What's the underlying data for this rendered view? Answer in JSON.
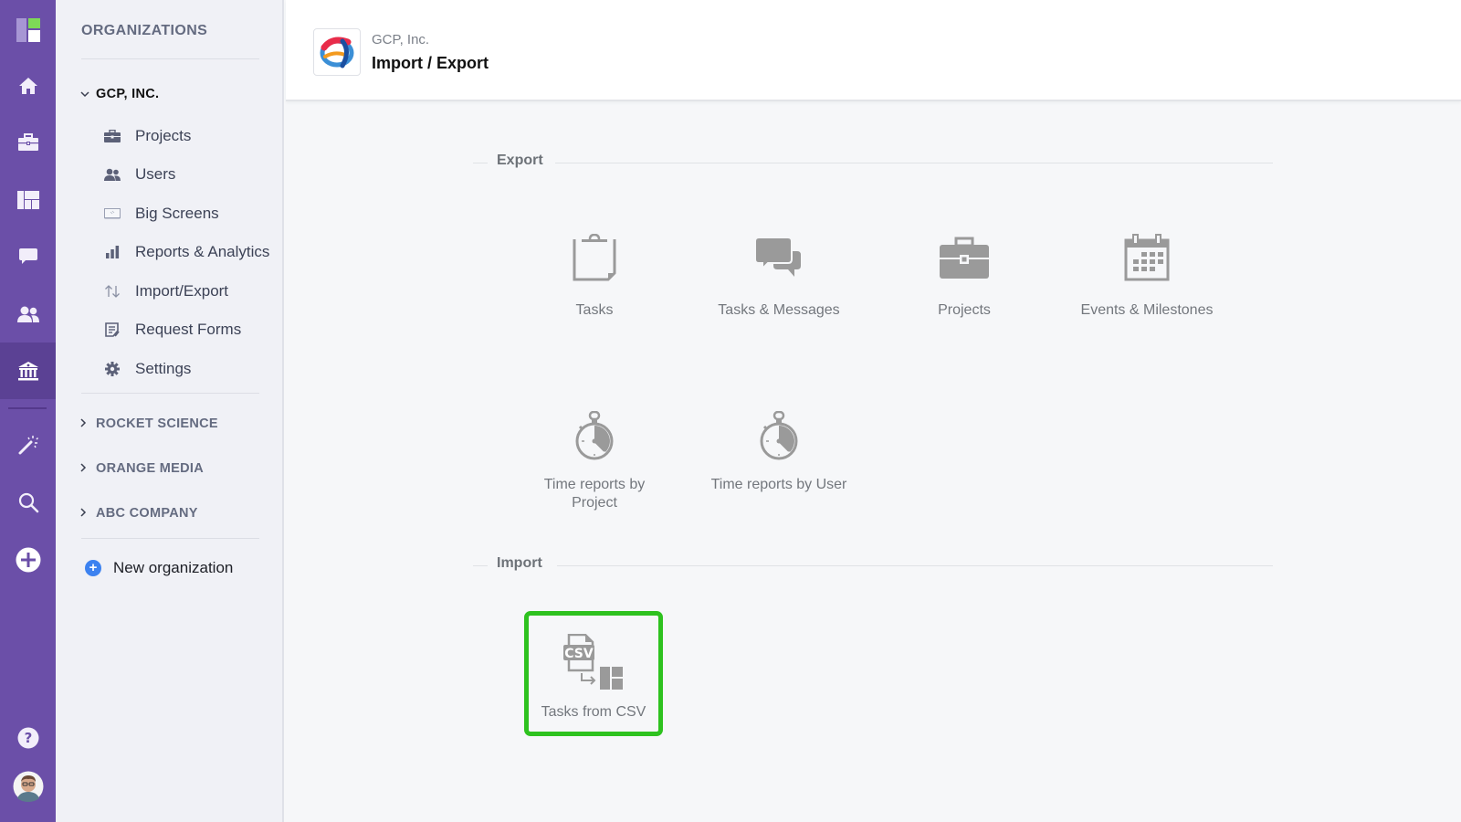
{
  "rail": {
    "items": [
      {
        "name": "app-logo",
        "icon": "app-logo-icon"
      },
      {
        "name": "home",
        "icon": "home-icon"
      },
      {
        "name": "projects",
        "icon": "briefcase-icon"
      },
      {
        "name": "boards",
        "icon": "dashboard-icon"
      },
      {
        "name": "messages",
        "icon": "chat-icon"
      },
      {
        "name": "users",
        "icon": "users-icon"
      },
      {
        "name": "organizations",
        "icon": "bank-icon",
        "active": true
      },
      {
        "name": "magic",
        "icon": "magic-wand-icon"
      },
      {
        "name": "search",
        "icon": "search-icon"
      },
      {
        "name": "add",
        "icon": "plus-circle-icon"
      },
      {
        "name": "help",
        "icon": "help-icon"
      },
      {
        "name": "profile",
        "icon": "avatar"
      }
    ],
    "colors": {
      "background": "#6b4fa8",
      "active": "#5b4194",
      "logo_green": "#7ed957"
    }
  },
  "sidebar": {
    "title": "ORGANIZATIONS",
    "current_org": {
      "name": "GCP, INC.",
      "expanded": true,
      "items": [
        {
          "label": "Projects",
          "icon": "briefcase-icon"
        },
        {
          "label": "Users",
          "icon": "users-icon"
        },
        {
          "label": "Big Screens",
          "icon": "screen-icon"
        },
        {
          "label": "Reports & Analytics",
          "icon": "bar-chart-icon"
        },
        {
          "label": "Import/Export",
          "icon": "arrows-up-down-icon"
        },
        {
          "label": "Request Forms",
          "icon": "form-icon"
        },
        {
          "label": "Settings",
          "icon": "gear-icon"
        }
      ]
    },
    "other_orgs": [
      {
        "name": "ROCKET SCIENCE"
      },
      {
        "name": "ORANGE MEDIA"
      },
      {
        "name": "ABC COMPANY"
      }
    ],
    "new_org_label": "New organization",
    "new_org_icon": "+"
  },
  "header": {
    "org_name": "GCP, Inc.",
    "title": "Import / Export"
  },
  "export": {
    "title": "Export",
    "items": [
      {
        "label": "Tasks",
        "icon": "clipboard-icon"
      },
      {
        "label": "Tasks & Messages",
        "icon": "chat-bubbles-icon"
      },
      {
        "label": "Projects",
        "icon": "briefcase-icon"
      },
      {
        "label": "Events & Milestones",
        "icon": "calendar-icon"
      },
      {
        "label": "Time reports by Project",
        "icon": "stopwatch-icon"
      },
      {
        "label": "Time reports by User",
        "icon": "stopwatch-icon"
      }
    ]
  },
  "import": {
    "title": "Import",
    "items": [
      {
        "label": "Tasks from CSV",
        "icon": "csv-import-icon",
        "highlighted": true
      }
    ]
  },
  "colors": {
    "highlight_border": "#2ec21f",
    "icon_gray": "#9a9a9a",
    "new_org_blue": "#3c82f0"
  }
}
